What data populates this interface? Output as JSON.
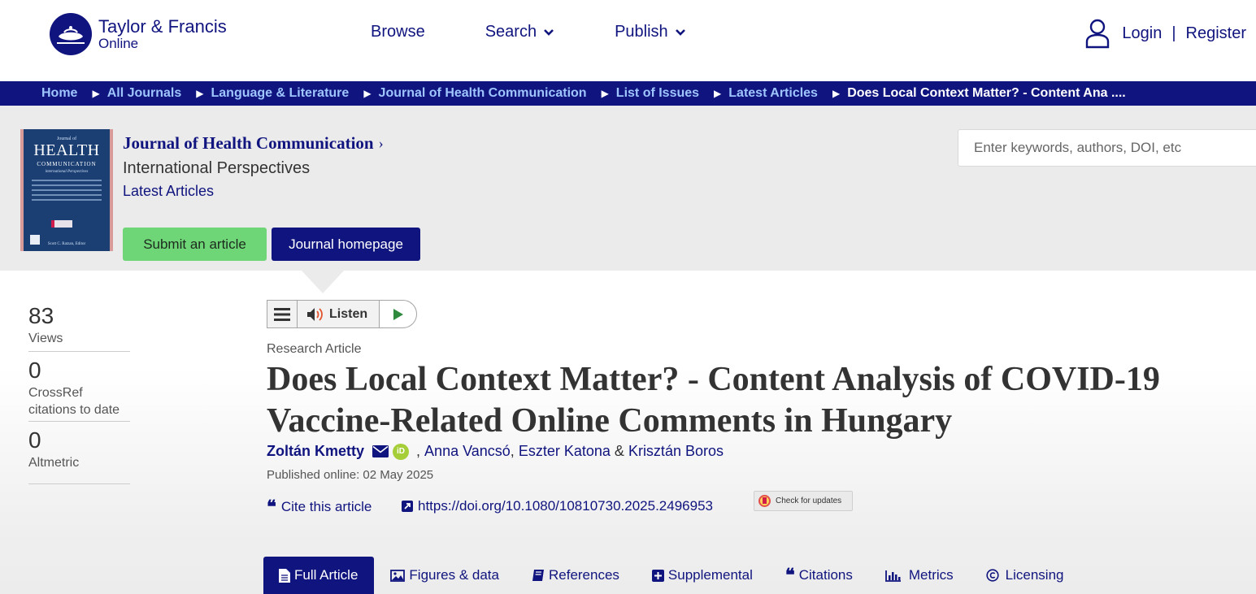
{
  "header": {
    "logo_line1": "Taylor & Francis",
    "logo_line2": "Online",
    "nav": {
      "browse": "Browse",
      "search": "Search",
      "publish": "Publish"
    },
    "login": "Login",
    "separator": "|",
    "register": "Register"
  },
  "breadcrumb": {
    "items": [
      "Home",
      "All Journals",
      "Language & Literature",
      "Journal of Health Communication",
      "List of Issues",
      "Latest Articles"
    ],
    "current": "Does Local Context Matter? - Content Ana ....",
    "separator_glyph": "▶"
  },
  "journal": {
    "cover": {
      "top": "Journal of",
      "name": "HEALTH",
      "sub": "COMMUNICATION",
      "tagline": "international Perspectives",
      "footer": "Scott C. Ratzan, Editor"
    },
    "title": "Journal of Health Communication",
    "subtitle": "International Perspectives",
    "latest_link": "Latest Articles",
    "submit_label": "Submit an article",
    "homepage_label": "Journal homepage"
  },
  "search": {
    "placeholder": "Enter keywords, authors, DOI, etc"
  },
  "metrics": {
    "views_count": "83",
    "views_label": "Views",
    "crossref_count": "0",
    "crossref_label_1": "CrossRef",
    "crossref_label_2": "citations to date",
    "altmetric_count": "0",
    "altmetric_label": "Altmetric"
  },
  "player": {
    "listen_label": "Listen"
  },
  "article": {
    "type": "Research Article",
    "title": "Does Local Context Matter? - Content Analysis of COVID-19 Vaccine-Related Online Comments in Hungary",
    "author_main": "Zoltán Kmetty",
    "orcid_glyph": "iD",
    "author_2": "Anna Vancsó",
    "author_3": "Eszter Katona",
    "author_4": "Krisztán Boros",
    "comma": ",",
    "ampersand": "&",
    "published": "Published online: 02 May 2025",
    "cite_quote": "❝",
    "cite_label": "Cite this article",
    "doi": "https://doi.org/10.1080/10810730.2025.2496953",
    "check_updates": "Check for updates"
  },
  "tabs": [
    {
      "label": "Full Article",
      "icon": "document-icon"
    },
    {
      "label": "Figures & data",
      "icon": "image-icon"
    },
    {
      "label": "References",
      "icon": "book-icon"
    },
    {
      "label": "Supplemental",
      "icon": "plus-square-icon"
    },
    {
      "label": "Citations",
      "icon": "quote-icon"
    },
    {
      "label": "Metrics",
      "icon": "bar-chart-icon"
    },
    {
      "label": "Licensing",
      "icon": "copyright-icon"
    }
  ],
  "colors": {
    "brand_navy": "#10147e",
    "breadcrumb_link": "#9fc5ff",
    "submit_green": "#6fd677",
    "banner_gray": "#ebebeb",
    "orcid_green": "#a6ce39"
  }
}
